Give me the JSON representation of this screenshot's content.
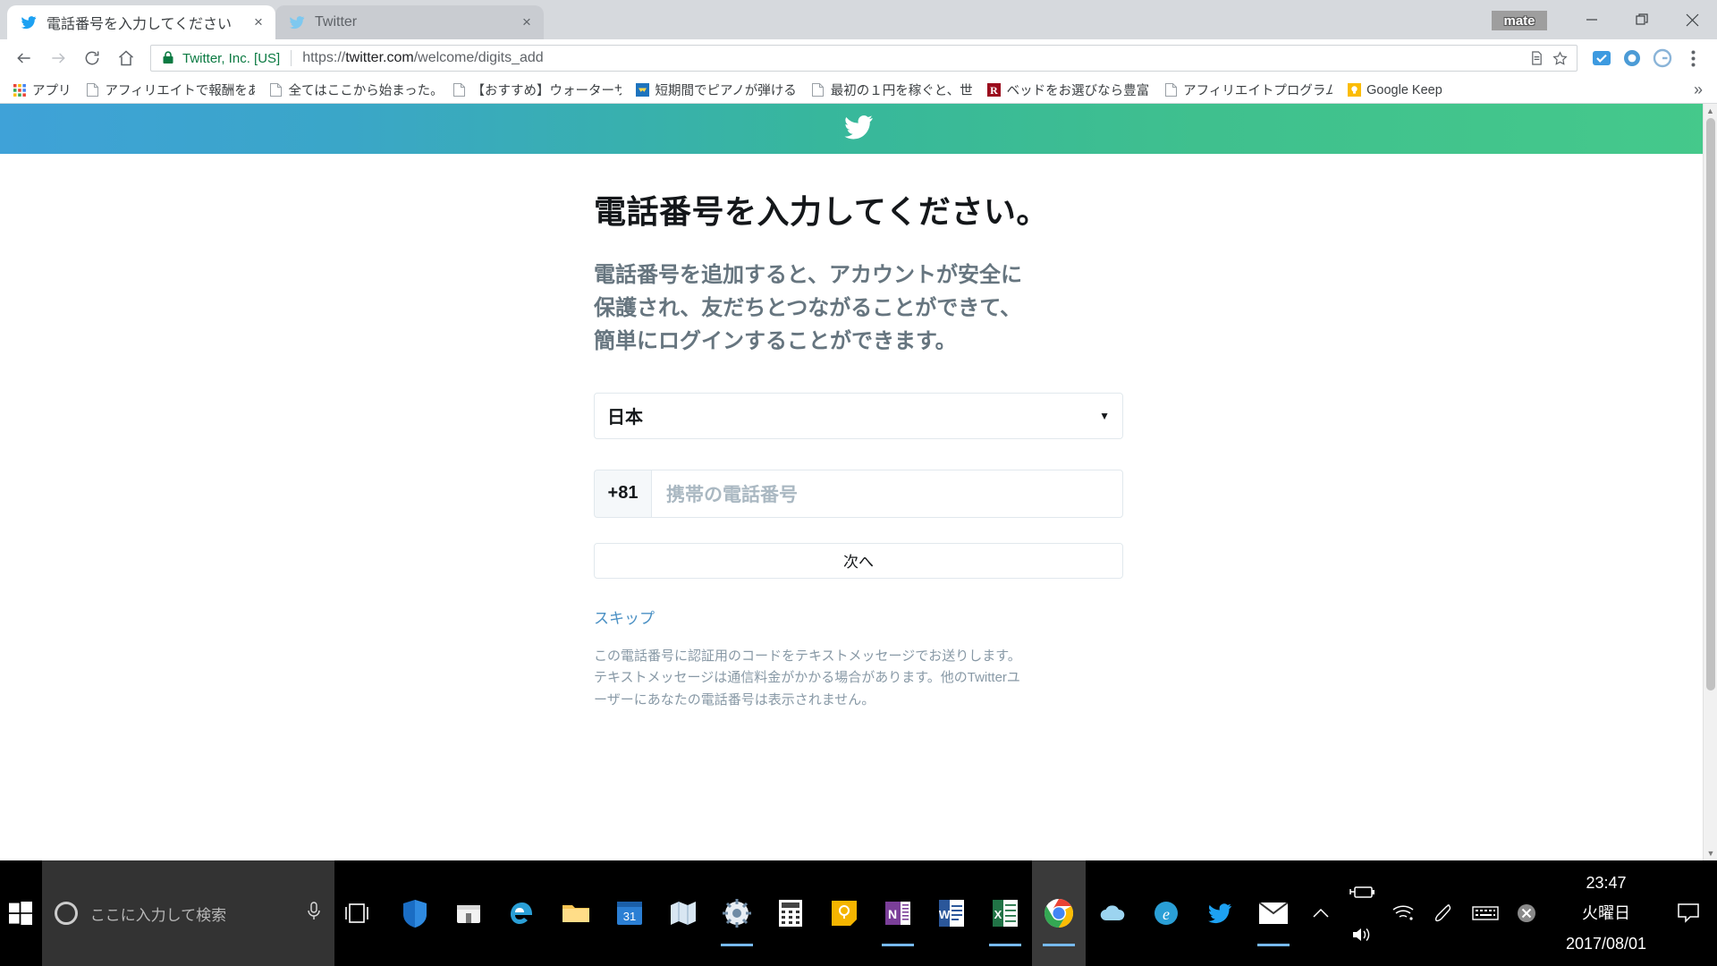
{
  "browser": {
    "window_badge": "mate",
    "tabs": [
      {
        "title": "電話番号を入力してください",
        "favicon": "twitter-bird-icon",
        "close_label": "×",
        "active": true
      },
      {
        "title": "Twitter",
        "favicon": "twitter-bird-icon",
        "close_label": "×",
        "active": false
      }
    ],
    "window_controls": {
      "minimize": "—",
      "maximize": "❐",
      "close": "✕"
    },
    "nav": {
      "back": "←",
      "forward": "→",
      "reload": "⟳",
      "home": "⌂"
    },
    "omnibox": {
      "security_label": "Twitter, Inc. [US]",
      "lock_icon": "lock-icon",
      "url_scheme": "https://",
      "url_host": "twitter.com",
      "url_path": "/welcome/digits_add",
      "full_url": "https://twitter.com/welcome/digits_add",
      "save_icon": "page-save-icon",
      "bookmark_icon": "star-icon"
    },
    "extensions": [
      {
        "name": "checkmark-extension-icon",
        "color": "#38a3e0"
      },
      {
        "name": "circle-extension-icon",
        "color": "#4d9fd6"
      },
      {
        "name": "g-extension-icon",
        "color": "#8ab4d8"
      }
    ],
    "menu_icon": "kebab-menu-icon",
    "bookmarks": [
      {
        "label": "アプリ",
        "icon": "apps-grid-icon"
      },
      {
        "label": "アフィリエイトで報酬をあ",
        "icon": "page-icon"
      },
      {
        "label": "全てはここから始まった。",
        "icon": "page-icon"
      },
      {
        "label": "【おすすめ】ウォーターサー",
        "icon": "page-icon"
      },
      {
        "label": "短期間でピアノが弾ける",
        "icon": "yellow-bird-icon"
      },
      {
        "label": "最初の１円を稼ぐと、世",
        "icon": "page-icon"
      },
      {
        "label": "ベッドをお選びなら豊富",
        "icon": "rakuten-r-icon"
      },
      {
        "label": "アフィリエイトプログラムの",
        "icon": "page-icon"
      },
      {
        "label": "Google Keep",
        "icon": "keep-bulb-icon"
      }
    ],
    "bookmarks_overflow": "»"
  },
  "page": {
    "brand_icon": "twitter-bird-icon",
    "title": "電話番号を入力してください。",
    "subtitle": "電話番号を追加すると、アカウントが安全に保護され、友だちとつながることができて、簡単にログインすることができます。",
    "country_select": {
      "value": "日本",
      "caret": "▼"
    },
    "country_code": "+81",
    "phone_placeholder": "携帯の電話番号",
    "next_button": "次へ",
    "skip_link": "スキップ",
    "fineprint": "この電話番号に認証用のコードをテキストメッセージでお送りします。テキストメッセージは通信料金がかかる場合があります。他のTwitterユーザーにあなたの電話番号は表示されません。",
    "accent_gradient_from": "#3fa2d8",
    "accent_gradient_to": "#45c98b",
    "link_color": "#4a90c4"
  },
  "taskbar": {
    "start_icon": "windows-start-icon",
    "search_placeholder": "ここに入力して検索",
    "cortana_icon": "cortana-circle-icon",
    "mic_icon": "microphone-icon",
    "taskview_icon": "task-view-icon",
    "pinned": [
      {
        "name": "windows-defender-icon",
        "running": false
      },
      {
        "name": "microsoft-store-icon",
        "running": false
      },
      {
        "name": "microsoft-edge-icon",
        "running": false
      },
      {
        "name": "file-explorer-icon",
        "running": false
      },
      {
        "name": "calendar-icon",
        "running": false
      },
      {
        "name": "maps-icon",
        "running": false
      },
      {
        "name": "settings-icon",
        "running": true
      },
      {
        "name": "calculator-icon",
        "running": false
      },
      {
        "name": "sticky-notes-icon",
        "running": false
      },
      {
        "name": "onenote-icon",
        "running": true
      },
      {
        "name": "word-icon",
        "running": false
      },
      {
        "name": "excel-icon",
        "running": true
      },
      {
        "name": "google-chrome-icon",
        "running": true,
        "active": true
      },
      {
        "name": "onedrive-icon",
        "running": false
      },
      {
        "name": "internet-explorer-icon",
        "running": false
      },
      {
        "name": "twitter-icon",
        "running": false
      },
      {
        "name": "mail-icon",
        "running": true
      }
    ],
    "tray": [
      {
        "name": "show-hidden-icons-chevron"
      },
      {
        "name": "battery-charging-icon"
      },
      {
        "name": "volume-icon"
      },
      {
        "name": "wifi-icon"
      },
      {
        "name": "ime-pen-icon"
      },
      {
        "name": "touch-keyboard-icon"
      },
      {
        "name": "ime-disabled-icon"
      }
    ],
    "clock": {
      "time": "23:47",
      "weekday": "火曜日",
      "date": "2017/08/01"
    },
    "notification_icon": "action-center-icon"
  }
}
